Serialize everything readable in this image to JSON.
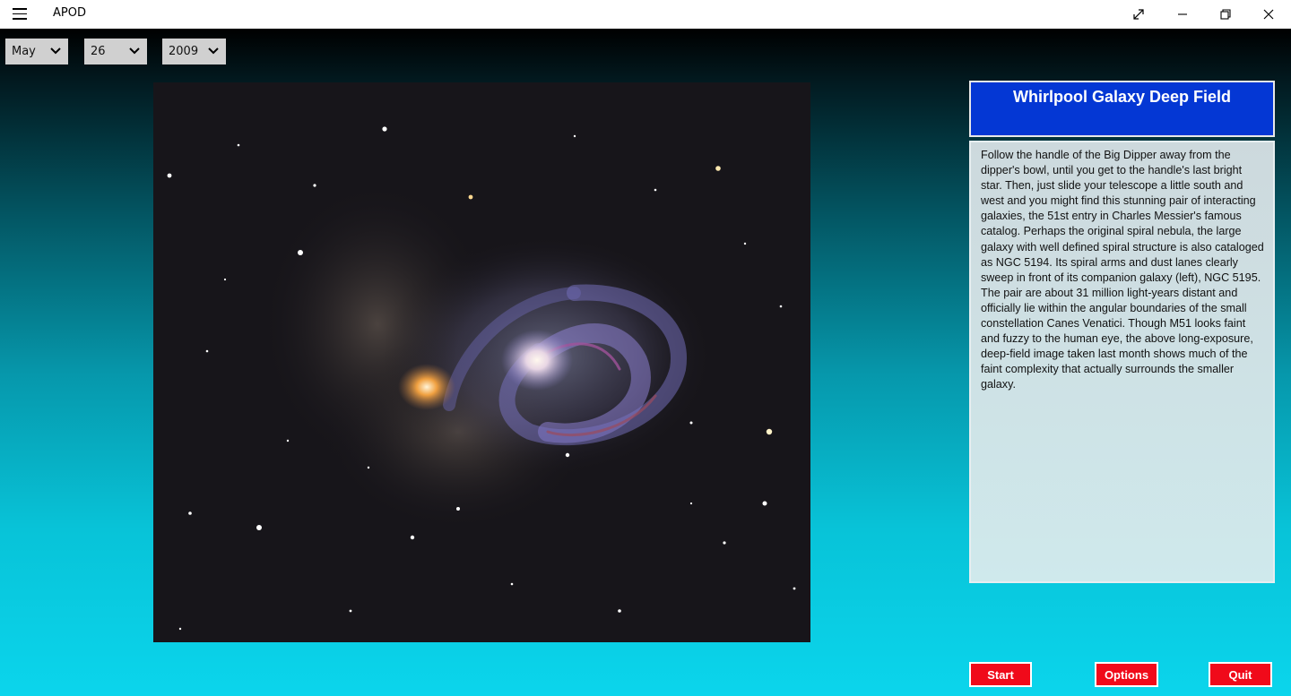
{
  "window": {
    "title": "APOD"
  },
  "date": {
    "month": "May",
    "day": "26",
    "year": "2009"
  },
  "apod": {
    "title": "Whirlpool Galaxy Deep Field",
    "explanation": "Follow the handle of the Big Dipper away from the dipper's bowl, until you get to the handle's last bright star. Then, just slide your telescope a little south and west and you might find this stunning pair of interacting galaxies, the 51st entry in Charles Messier's famous catalog. Perhaps the original spiral nebula, the large galaxy with well defined spiral structure is also cataloged as NGC 5194. Its spiral arms and dust lanes clearly sweep in front of its companion galaxy (left), NGC 5195. The pair are about 31 million light-years distant and officially lie within the angular boundaries of the small constellation Canes Venatici. Though M51 looks faint and fuzzy to the human eye, the above long-exposure, deep-field image taken last month shows much of the faint complexity that actually surrounds the smaller galaxy."
  },
  "buttons": {
    "start": "Start",
    "options": "Options",
    "quit": "Quit"
  },
  "colors": {
    "title_box": "#0437d4",
    "action_button": "#f00a1a",
    "gradient_bottom": "#0bd5ec"
  },
  "icons": {
    "menu": "hamburger-icon",
    "expand": "expand-icon",
    "minimize": "minimize-icon",
    "restore": "restore-icon",
    "close": "close-icon",
    "dropdown": "chevron-down-icon"
  }
}
